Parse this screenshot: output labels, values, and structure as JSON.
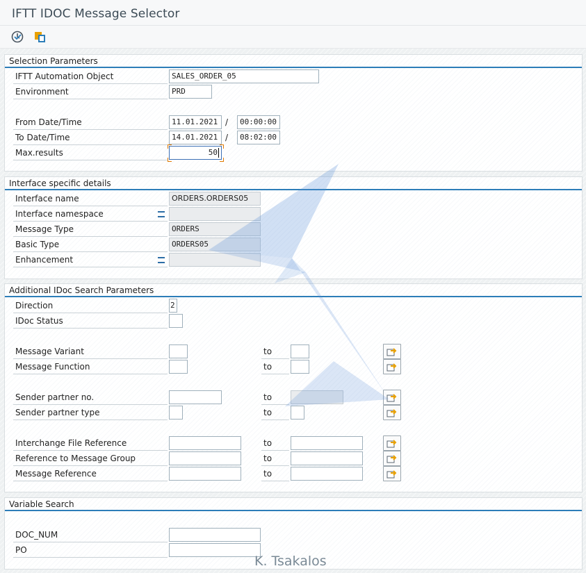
{
  "window": {
    "title": "IFTT IDOC Message Selector"
  },
  "toolbar": {
    "execute_icon": "execute-clock-icon",
    "variants_icon": "get-variant-icon"
  },
  "groups": {
    "selection": {
      "title": "Selection Parameters",
      "automation_object": {
        "label": "IFTT Automation Object",
        "value": "SALES_ORDER_05"
      },
      "environment": {
        "label": "Environment",
        "value": "PRD"
      },
      "from": {
        "label": "From Date/Time",
        "date": "11.01.2021",
        "sep": "/",
        "time": "00:00:00"
      },
      "to": {
        "label": "To Date/Time",
        "date": "14.01.2021",
        "sep": "/",
        "time": "08:02:00"
      },
      "max_results": {
        "label": "Max.results",
        "value": "50"
      }
    },
    "interface": {
      "title": "Interface specific details",
      "interface_name": {
        "label": "Interface name",
        "value": "ORDERS.ORDERS05"
      },
      "interface_namespace": {
        "label": "Interface namespace",
        "value": ""
      },
      "message_type": {
        "label": "Message Type",
        "value": "ORDERS"
      },
      "basic_type": {
        "label": "Basic Type",
        "value": "ORDERS05"
      },
      "enhancement": {
        "label": "Enhancement",
        "value": ""
      }
    },
    "additional": {
      "title": "Additional IDoc Search Parameters",
      "to_label": "to",
      "direction": {
        "label": "Direction",
        "value": "2"
      },
      "idoc_status": {
        "label": "IDoc Status",
        "value": ""
      },
      "message_variant": {
        "label": "Message Variant",
        "from": "",
        "to": ""
      },
      "message_function": {
        "label": "Message Function",
        "from": "",
        "to": ""
      },
      "sender_partner_no": {
        "label": "Sender partner no.",
        "from": "",
        "to": ""
      },
      "sender_partner_type": {
        "label": "Sender partner type",
        "from": "",
        "to": ""
      },
      "interchange_file_ref": {
        "label": "Interchange File Reference",
        "from": "",
        "to": ""
      },
      "ref_message_group": {
        "label": "Reference to Message Group",
        "from": "",
        "to": ""
      },
      "message_reference": {
        "label": "Message Reference",
        "from": "",
        "to": ""
      }
    },
    "variable": {
      "title": "Variable Search",
      "doc_num": {
        "label": "DOC_NUM",
        "value": ""
      },
      "po": {
        "label": "PO",
        "value": ""
      }
    }
  },
  "watermark": {
    "text": "K. Tsakalos"
  },
  "colors": {
    "accent": "#2c7db8",
    "multiple_selection_arrow": "#e8a000"
  }
}
